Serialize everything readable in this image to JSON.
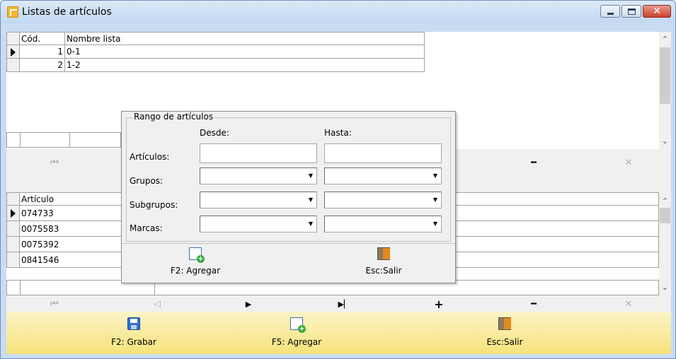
{
  "window": {
    "title": "Listas de artículos"
  },
  "title_buttons": [
    "minimize",
    "maximize",
    "close"
  ],
  "lists_grid": {
    "columns": [
      "Cód.",
      "Nombre lista"
    ],
    "rows": [
      {
        "code": "1",
        "name": "0-1"
      },
      {
        "code": "2",
        "name": "1-2"
      }
    ]
  },
  "articles_grid": {
    "columns": [
      "Artículo"
    ],
    "rows": [
      "074733",
      "0075583",
      "0075392",
      "0841546"
    ]
  },
  "navigator_icons": [
    "first-icon",
    "prior-icon",
    "next-icon",
    "last-icon",
    "insert-icon",
    "delete-icon",
    "cancel-icon"
  ],
  "toolbar": {
    "save": "F2: Grabar",
    "add": "F5: Agregar",
    "exit": "Esc:Salir"
  },
  "popup": {
    "legend": "Rango de artículos",
    "desde": "Desde:",
    "hasta": "Hasta:",
    "articulos": "Artículos:",
    "grupos": "Grupos:",
    "subgrupos": "Subgrupos:",
    "marcas": "Marcas:",
    "add": "F2: Agregar",
    "exit": "Esc:Salir"
  }
}
